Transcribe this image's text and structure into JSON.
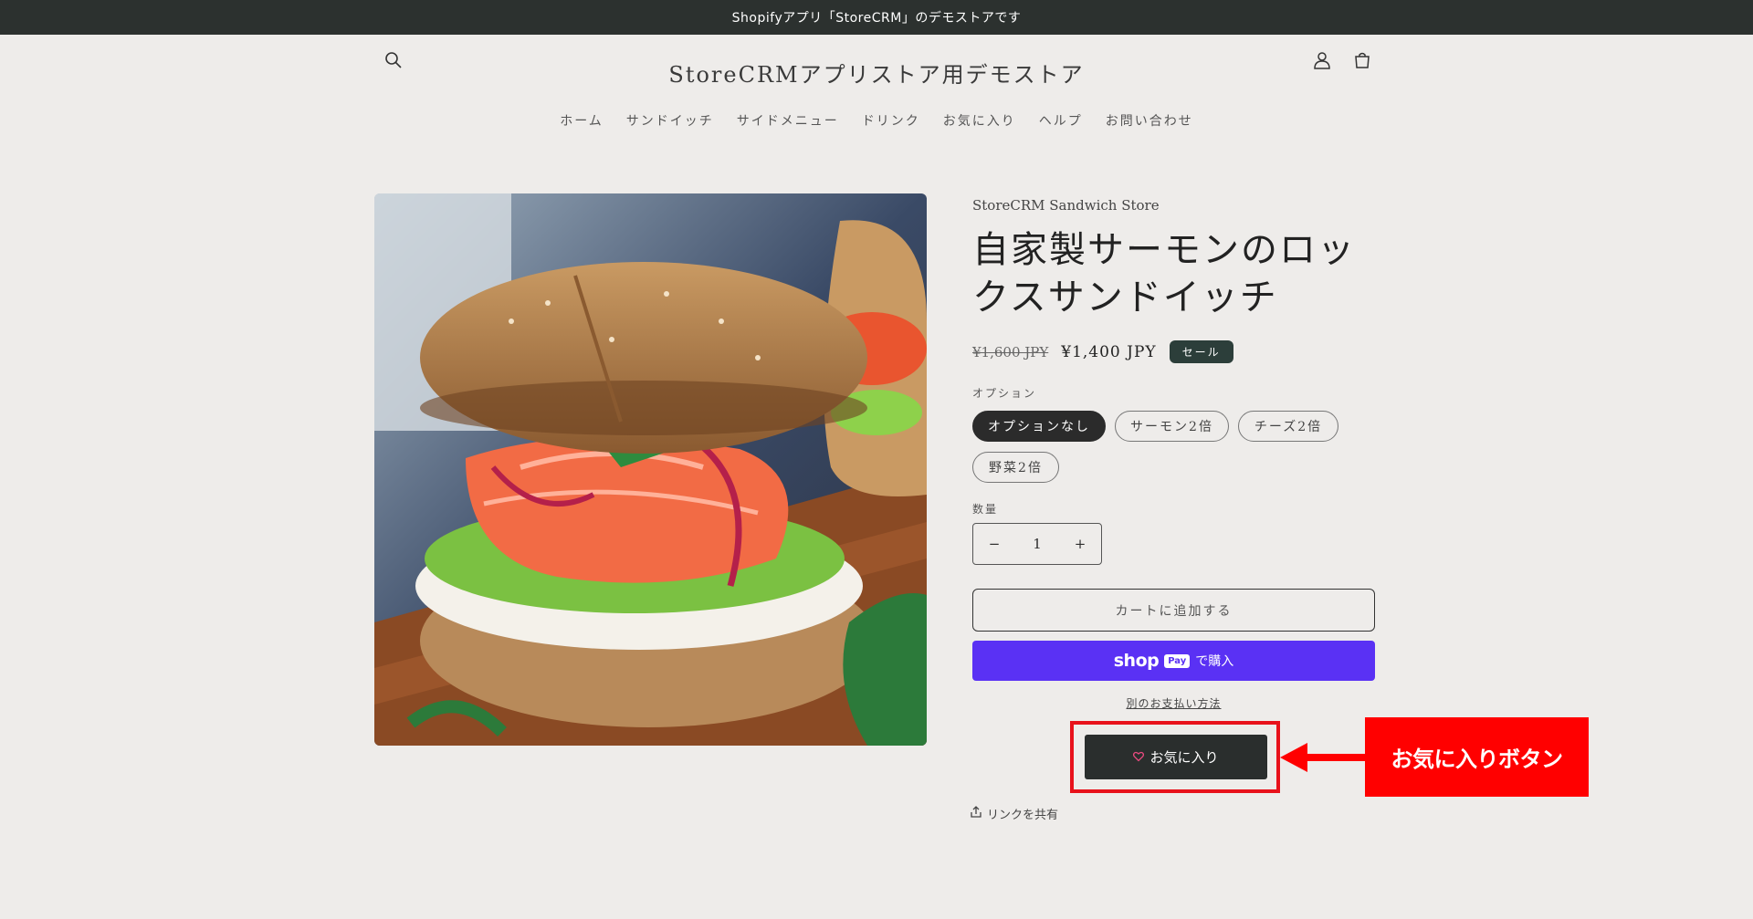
{
  "announcement": "Shopifyアプリ「StoreCRM」のデモストアです",
  "header": {
    "logo": "StoreCRMアプリストア用デモストア",
    "icons": [
      "search-icon",
      "account-icon",
      "cart-icon"
    ],
    "nav": [
      "ホーム",
      "サンドイッチ",
      "サイドメニュー",
      "ドリンク",
      "お気に入り",
      "ヘルプ",
      "お問い合わせ"
    ]
  },
  "product": {
    "vendor": "StoreCRM Sandwich Store",
    "title": "自家製サーモンのロックスサンドイッチ",
    "price_old": "¥1,600 JPY",
    "price_new": "¥1,400 JPY",
    "badge": "セール",
    "option_label": "オプション",
    "options": [
      "オプションなし",
      "サーモン2倍",
      "チーズ2倍",
      "野菜2倍"
    ],
    "selected_option": "オプションなし",
    "quantity_label": "数量",
    "quantity": "1",
    "minus": "−",
    "plus": "+",
    "add_to_cart": "カートに追加する",
    "shop_word": "shop",
    "pay_word": "Pay",
    "buy_text": "で購入",
    "other_payment": "別のお支払い方法",
    "favorite_button": "お気に入り",
    "share": "リンクを共有"
  },
  "annotation": {
    "callout": "お気に入りボタン",
    "color": "#ff0000"
  },
  "colors": {
    "background": "#eeecea",
    "announcement_bg": "#2c312f",
    "shop_pay": "#5a31f4",
    "badge": "#2c3e3a"
  }
}
